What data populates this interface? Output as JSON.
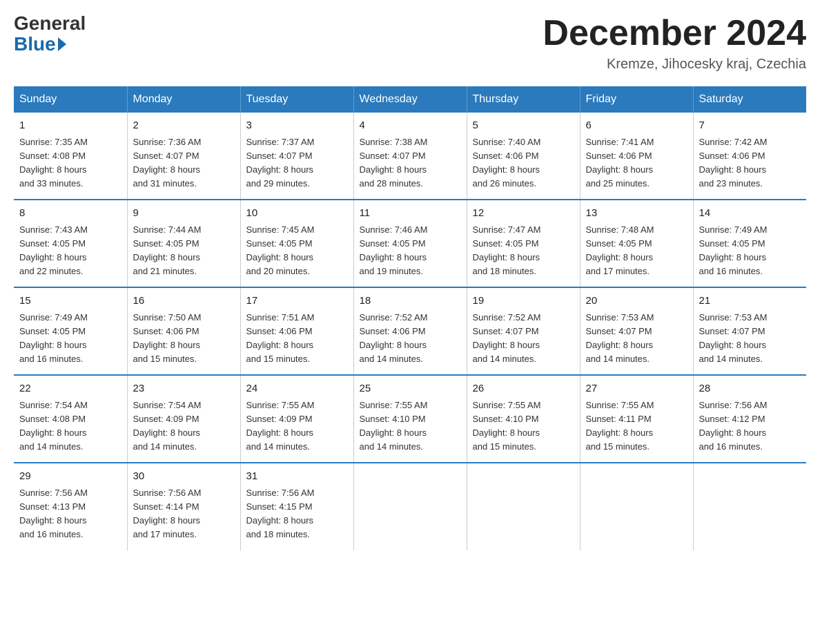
{
  "header": {
    "logo": {
      "general": "General",
      "blue": "Blue"
    },
    "title": "December 2024",
    "location": "Kremze, Jihocesky kraj, Czechia"
  },
  "days_of_week": [
    "Sunday",
    "Monday",
    "Tuesday",
    "Wednesday",
    "Thursday",
    "Friday",
    "Saturday"
  ],
  "weeks": [
    [
      {
        "day": "1",
        "sunrise": "Sunrise: 7:35 AM",
        "sunset": "Sunset: 4:08 PM",
        "daylight": "Daylight: 8 hours",
        "daylight2": "and 33 minutes."
      },
      {
        "day": "2",
        "sunrise": "Sunrise: 7:36 AM",
        "sunset": "Sunset: 4:07 PM",
        "daylight": "Daylight: 8 hours",
        "daylight2": "and 31 minutes."
      },
      {
        "day": "3",
        "sunrise": "Sunrise: 7:37 AM",
        "sunset": "Sunset: 4:07 PM",
        "daylight": "Daylight: 8 hours",
        "daylight2": "and 29 minutes."
      },
      {
        "day": "4",
        "sunrise": "Sunrise: 7:38 AM",
        "sunset": "Sunset: 4:07 PM",
        "daylight": "Daylight: 8 hours",
        "daylight2": "and 28 minutes."
      },
      {
        "day": "5",
        "sunrise": "Sunrise: 7:40 AM",
        "sunset": "Sunset: 4:06 PM",
        "daylight": "Daylight: 8 hours",
        "daylight2": "and 26 minutes."
      },
      {
        "day": "6",
        "sunrise": "Sunrise: 7:41 AM",
        "sunset": "Sunset: 4:06 PM",
        "daylight": "Daylight: 8 hours",
        "daylight2": "and 25 minutes."
      },
      {
        "day": "7",
        "sunrise": "Sunrise: 7:42 AM",
        "sunset": "Sunset: 4:06 PM",
        "daylight": "Daylight: 8 hours",
        "daylight2": "and 23 minutes."
      }
    ],
    [
      {
        "day": "8",
        "sunrise": "Sunrise: 7:43 AM",
        "sunset": "Sunset: 4:05 PM",
        "daylight": "Daylight: 8 hours",
        "daylight2": "and 22 minutes."
      },
      {
        "day": "9",
        "sunrise": "Sunrise: 7:44 AM",
        "sunset": "Sunset: 4:05 PM",
        "daylight": "Daylight: 8 hours",
        "daylight2": "and 21 minutes."
      },
      {
        "day": "10",
        "sunrise": "Sunrise: 7:45 AM",
        "sunset": "Sunset: 4:05 PM",
        "daylight": "Daylight: 8 hours",
        "daylight2": "and 20 minutes."
      },
      {
        "day": "11",
        "sunrise": "Sunrise: 7:46 AM",
        "sunset": "Sunset: 4:05 PM",
        "daylight": "Daylight: 8 hours",
        "daylight2": "and 19 minutes."
      },
      {
        "day": "12",
        "sunrise": "Sunrise: 7:47 AM",
        "sunset": "Sunset: 4:05 PM",
        "daylight": "Daylight: 8 hours",
        "daylight2": "and 18 minutes."
      },
      {
        "day": "13",
        "sunrise": "Sunrise: 7:48 AM",
        "sunset": "Sunset: 4:05 PM",
        "daylight": "Daylight: 8 hours",
        "daylight2": "and 17 minutes."
      },
      {
        "day": "14",
        "sunrise": "Sunrise: 7:49 AM",
        "sunset": "Sunset: 4:05 PM",
        "daylight": "Daylight: 8 hours",
        "daylight2": "and 16 minutes."
      }
    ],
    [
      {
        "day": "15",
        "sunrise": "Sunrise: 7:49 AM",
        "sunset": "Sunset: 4:05 PM",
        "daylight": "Daylight: 8 hours",
        "daylight2": "and 16 minutes."
      },
      {
        "day": "16",
        "sunrise": "Sunrise: 7:50 AM",
        "sunset": "Sunset: 4:06 PM",
        "daylight": "Daylight: 8 hours",
        "daylight2": "and 15 minutes."
      },
      {
        "day": "17",
        "sunrise": "Sunrise: 7:51 AM",
        "sunset": "Sunset: 4:06 PM",
        "daylight": "Daylight: 8 hours",
        "daylight2": "and 15 minutes."
      },
      {
        "day": "18",
        "sunrise": "Sunrise: 7:52 AM",
        "sunset": "Sunset: 4:06 PM",
        "daylight": "Daylight: 8 hours",
        "daylight2": "and 14 minutes."
      },
      {
        "day": "19",
        "sunrise": "Sunrise: 7:52 AM",
        "sunset": "Sunset: 4:07 PM",
        "daylight": "Daylight: 8 hours",
        "daylight2": "and 14 minutes."
      },
      {
        "day": "20",
        "sunrise": "Sunrise: 7:53 AM",
        "sunset": "Sunset: 4:07 PM",
        "daylight": "Daylight: 8 hours",
        "daylight2": "and 14 minutes."
      },
      {
        "day": "21",
        "sunrise": "Sunrise: 7:53 AM",
        "sunset": "Sunset: 4:07 PM",
        "daylight": "Daylight: 8 hours",
        "daylight2": "and 14 minutes."
      }
    ],
    [
      {
        "day": "22",
        "sunrise": "Sunrise: 7:54 AM",
        "sunset": "Sunset: 4:08 PM",
        "daylight": "Daylight: 8 hours",
        "daylight2": "and 14 minutes."
      },
      {
        "day": "23",
        "sunrise": "Sunrise: 7:54 AM",
        "sunset": "Sunset: 4:09 PM",
        "daylight": "Daylight: 8 hours",
        "daylight2": "and 14 minutes."
      },
      {
        "day": "24",
        "sunrise": "Sunrise: 7:55 AM",
        "sunset": "Sunset: 4:09 PM",
        "daylight": "Daylight: 8 hours",
        "daylight2": "and 14 minutes."
      },
      {
        "day": "25",
        "sunrise": "Sunrise: 7:55 AM",
        "sunset": "Sunset: 4:10 PM",
        "daylight": "Daylight: 8 hours",
        "daylight2": "and 14 minutes."
      },
      {
        "day": "26",
        "sunrise": "Sunrise: 7:55 AM",
        "sunset": "Sunset: 4:10 PM",
        "daylight": "Daylight: 8 hours",
        "daylight2": "and 15 minutes."
      },
      {
        "day": "27",
        "sunrise": "Sunrise: 7:55 AM",
        "sunset": "Sunset: 4:11 PM",
        "daylight": "Daylight: 8 hours",
        "daylight2": "and 15 minutes."
      },
      {
        "day": "28",
        "sunrise": "Sunrise: 7:56 AM",
        "sunset": "Sunset: 4:12 PM",
        "daylight": "Daylight: 8 hours",
        "daylight2": "and 16 minutes."
      }
    ],
    [
      {
        "day": "29",
        "sunrise": "Sunrise: 7:56 AM",
        "sunset": "Sunset: 4:13 PM",
        "daylight": "Daylight: 8 hours",
        "daylight2": "and 16 minutes."
      },
      {
        "day": "30",
        "sunrise": "Sunrise: 7:56 AM",
        "sunset": "Sunset: 4:14 PM",
        "daylight": "Daylight: 8 hours",
        "daylight2": "and 17 minutes."
      },
      {
        "day": "31",
        "sunrise": "Sunrise: 7:56 AM",
        "sunset": "Sunset: 4:15 PM",
        "daylight": "Daylight: 8 hours",
        "daylight2": "and 18 minutes."
      },
      {
        "day": "",
        "sunrise": "",
        "sunset": "",
        "daylight": "",
        "daylight2": ""
      },
      {
        "day": "",
        "sunrise": "",
        "sunset": "",
        "daylight": "",
        "daylight2": ""
      },
      {
        "day": "",
        "sunrise": "",
        "sunset": "",
        "daylight": "",
        "daylight2": ""
      },
      {
        "day": "",
        "sunrise": "",
        "sunset": "",
        "daylight": "",
        "daylight2": ""
      }
    ]
  ]
}
